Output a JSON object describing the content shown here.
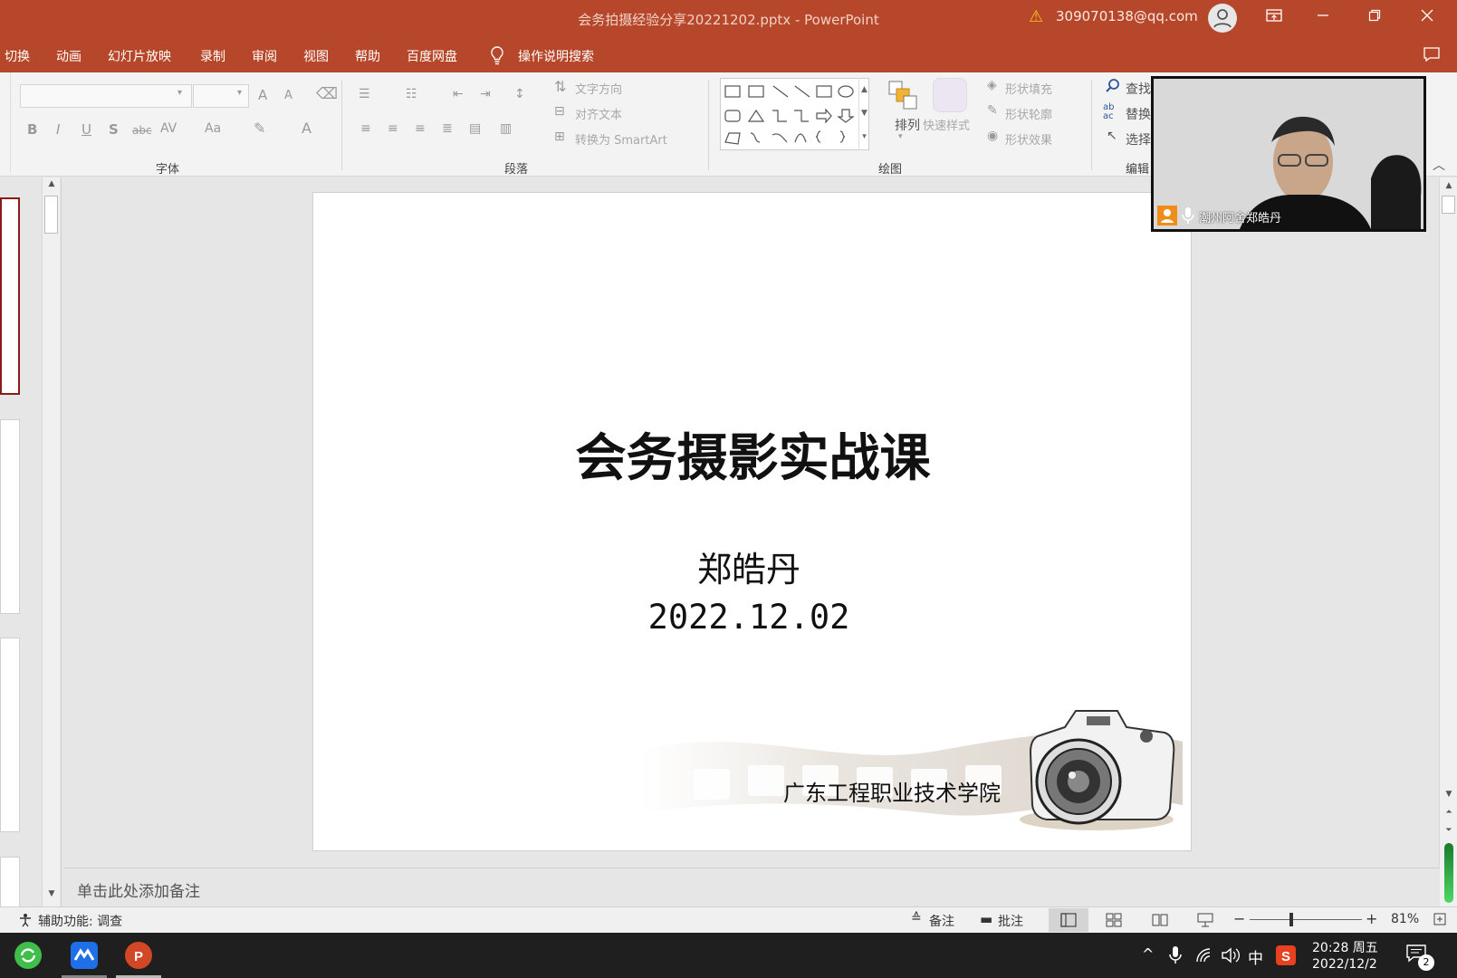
{
  "titlebar": {
    "document_title": "会务拍摄经验分享20221202.pptx  -  PowerPoint",
    "account": "309070138@qq.com",
    "warning_glyph": "⚠"
  },
  "menu": {
    "tabs": [
      "切换",
      "动画",
      "幻灯片放映",
      "录制",
      "审阅",
      "视图",
      "帮助",
      "百度网盘"
    ],
    "search_label": "操作说明搜索"
  },
  "ribbon": {
    "groups": {
      "font": "字体",
      "paragraph": "段落",
      "drawing": "绘图",
      "editing": "编辑"
    },
    "font_buttons": {
      "bold": "B",
      "italic": "I",
      "underline": "U",
      "shadow": "S",
      "strike": "abc",
      "spacing": "AV",
      "case": "Aa",
      "color": "A",
      "grow": "A",
      "shrink": "A"
    },
    "paragraph": {
      "text_direction": "文字方向",
      "align_text": "对齐文本",
      "smartart": "转换为 SmartArt"
    },
    "drawing": {
      "arrange": "排列",
      "quick_styles": "快速样式",
      "shape_fill": "形状填充",
      "shape_outline": "形状轮廓",
      "shape_effects": "形状效果"
    },
    "editing": {
      "find": "查找",
      "replace": "替换",
      "select": "选择",
      "replace_icon_text": "ab ac"
    }
  },
  "video": {
    "participant": "潮州阿舍郑皓丹"
  },
  "slide": {
    "title": "会务摄影实战课",
    "author": "郑皓丹",
    "date": "2022.12.02",
    "institution": "广东工程职业技术学院"
  },
  "notes": {
    "placeholder": "单击此处添加备注"
  },
  "status": {
    "accessibility": "辅助功能: 调查",
    "notes_btn": "备注",
    "comments_btn": "批注",
    "zoom_minus": "−",
    "zoom_plus": "+",
    "zoom": "81%"
  },
  "taskbar": {
    "time": "20:28 周五",
    "date": "2022/12/2",
    "ime": "中",
    "notifications": "2",
    "caret": "^"
  },
  "colors": {
    "accent": "#b7472a",
    "taskbar": "#1f1f1f"
  }
}
